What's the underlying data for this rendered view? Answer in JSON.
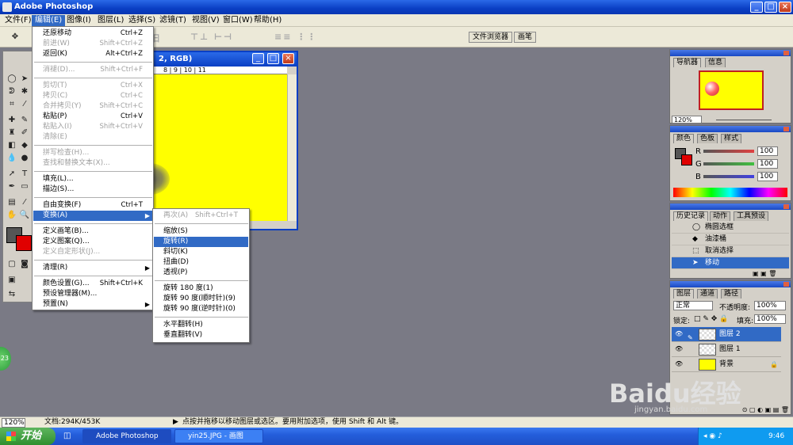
{
  "app": {
    "title": "Adobe Photoshop"
  },
  "menubar": [
    "文件(F)",
    "编辑(E)",
    "图像(I)",
    "图层(L)",
    "选择(S)",
    "滤镜(T)",
    "视图(V)",
    "窗口(W)",
    "帮助(H)"
  ],
  "options_bar": {
    "file_browser": "文件浏览器",
    "brushes": "画笔",
    "ghost_text": "汩"
  },
  "document": {
    "title": "2, RGB)",
    "ruler": "8 | 9 | 10 | 11",
    "fill_color": "#ffff00"
  },
  "edit_menu": [
    {
      "label": "还原移动",
      "shortcut": "Ctrl+Z",
      "disabled": false
    },
    {
      "label": "前进(W)",
      "shortcut": "Shift+Ctrl+Z",
      "disabled": true
    },
    {
      "label": "返回(K)",
      "shortcut": "Alt+Ctrl+Z",
      "disabled": false
    },
    {
      "label": "消褪(D)...",
      "shortcut": "Shift+Ctrl+F",
      "disabled": true
    },
    {
      "label": "剪切(T)",
      "shortcut": "Ctrl+X",
      "disabled": true
    },
    {
      "label": "拷贝(C)",
      "shortcut": "Ctrl+C",
      "disabled": true
    },
    {
      "label": "合并拷贝(Y)",
      "shortcut": "Shift+Ctrl+C",
      "disabled": true
    },
    {
      "label": "粘贴(P)",
      "shortcut": "Ctrl+V",
      "disabled": false
    },
    {
      "label": "粘贴入(I)",
      "shortcut": "Shift+Ctrl+V",
      "disabled": true
    },
    {
      "label": "清除(E)",
      "shortcut": "",
      "disabled": true
    },
    {
      "label": "拼写检查(H)...",
      "shortcut": "",
      "disabled": true
    },
    {
      "label": "查找和替换文本(X)...",
      "shortcut": "",
      "disabled": true
    },
    {
      "label": "填充(L)...",
      "shortcut": "",
      "disabled": false
    },
    {
      "label": "描边(S)...",
      "shortcut": "",
      "disabled": false
    },
    {
      "label": "自由变换(F)",
      "shortcut": "Ctrl+T",
      "disabled": false
    },
    {
      "label": "变换(A)",
      "shortcut": "",
      "disabled": false
    },
    {
      "label": "定义画笔(B)...",
      "shortcut": "",
      "disabled": false
    },
    {
      "label": "定义图案(Q)...",
      "shortcut": "",
      "disabled": false
    },
    {
      "label": "定义自定形状(J)...",
      "shortcut": "",
      "disabled": true
    },
    {
      "label": "清理(R)",
      "shortcut": "",
      "disabled": false
    },
    {
      "label": "颜色设置(G)...",
      "shortcut": "Shift+Ctrl+K",
      "disabled": false
    },
    {
      "label": "预设管理器(M)...",
      "shortcut": "",
      "disabled": false
    },
    {
      "label": "预置(N)",
      "shortcut": "",
      "disabled": false
    }
  ],
  "transform_submenu": [
    {
      "label": "再次(A)",
      "shortcut": "Shift+Ctrl+T",
      "disabled": true
    },
    {
      "label": "缩放(S)",
      "disabled": false
    },
    {
      "label": "旋转(R)",
      "disabled": false
    },
    {
      "label": "斜切(K)",
      "disabled": false
    },
    {
      "label": "扭曲(D)",
      "disabled": false
    },
    {
      "label": "透视(P)",
      "disabled": false
    },
    {
      "label": "旋转 180 度(1)",
      "disabled": false
    },
    {
      "label": "旋转 90 度(顺时针)(9)",
      "disabled": false
    },
    {
      "label": "旋转 90 度(逆时针)(0)",
      "disabled": false
    },
    {
      "label": "水平翻转(H)",
      "disabled": false
    },
    {
      "label": "垂直翻转(V)",
      "disabled": false
    }
  ],
  "navigator": {
    "tabs": [
      "导航器",
      "信息"
    ],
    "zoom": "120%"
  },
  "color_panel": {
    "tabs": [
      "颜色",
      "色板",
      "样式"
    ],
    "r_label": "R",
    "g_label": "G",
    "b_label": "B",
    "r": "100",
    "g": "100",
    "b": "100"
  },
  "history": {
    "tabs": [
      "历史记录",
      "动作",
      "工具预设"
    ],
    "items": [
      "椭圆选框",
      "油漆桶",
      "取消选择",
      "移动"
    ]
  },
  "layers": {
    "tabs": [
      "图层",
      "通道",
      "路径"
    ],
    "blend": "正常",
    "opacity_label": "不透明度:",
    "opacity": "100%",
    "lock_label": "锁定:",
    "fill_label": "填充:",
    "fill": "100%",
    "rows": [
      "图层 2",
      "图层 1",
      "背景"
    ]
  },
  "status": {
    "zoom": "120%",
    "doc": "文档:294K/453K",
    "hint": "点按并拖移以移动图层或选区。要用附加选项，使用 Shift 和 Alt 键。"
  },
  "taskbar": {
    "start": "开始",
    "tasks": [
      "Adobe Photoshop",
      "yin25.JPG - 画图"
    ],
    "clock": "9:46"
  },
  "watermark": {
    "brand": "Baidu经验",
    "url": "jingyan.baidu.com"
  },
  "colors": {
    "foreground": "#555555",
    "background": "#e00000",
    "canvas": "#ffff00",
    "selection": "#316ac5"
  },
  "floating_badge": "23"
}
